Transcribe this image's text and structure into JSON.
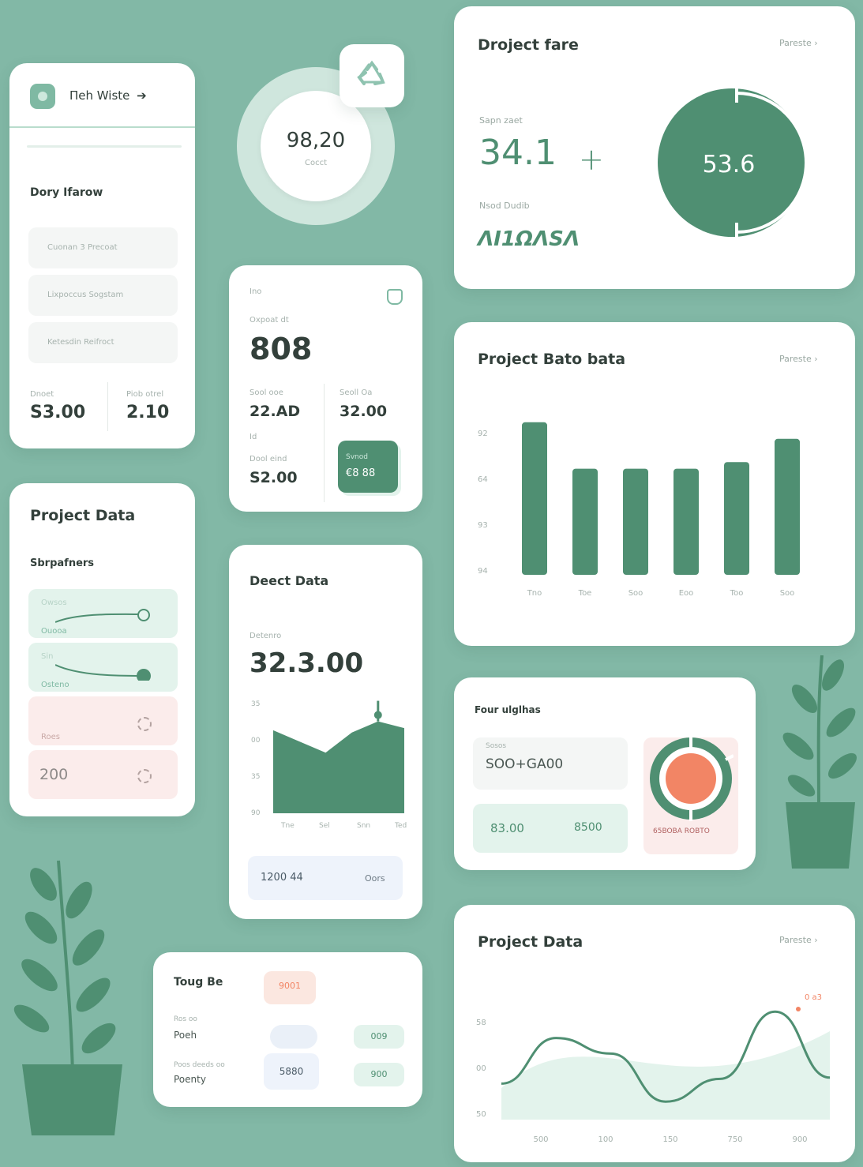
{
  "colors": {
    "background": "#82b8a6",
    "accent": "#4f8f72",
    "accent_light": "#e3f3ec",
    "coral": "#f28565",
    "pink_light": "#fbeceb"
  },
  "user_card": {
    "title": "Пeh Wiste",
    "section_title": "Dory Ifarow",
    "items": [
      "Cuonan 3 Precoat",
      "Lixpoccus Sogstam",
      "Ketesdin Reifroct"
    ],
    "stats": [
      {
        "label": "Dnoet",
        "value": "S3.00"
      },
      {
        "label": "Piob otrel",
        "value": "2.10"
      }
    ]
  },
  "ring_widget": {
    "value": "98,20",
    "label": "Cocct"
  },
  "project_fare": {
    "title": "Droject fare",
    "link": "Pareste",
    "label1": "Sapn zaet",
    "value1": "34.1",
    "plus": "+",
    "label2": "Nsod Dudib",
    "value2": "ΛΙ1ΩΛSΛ",
    "donut_value": "53.6",
    "donut_fraction": 0.5
  },
  "small_card": {
    "tag": "Ino",
    "label": "Oxpoat dt",
    "value": "808",
    "cells": [
      {
        "label": "Sool ooe",
        "value": "22.AD"
      },
      {
        "label": "Seoll Oa",
        "value": "32.00"
      },
      {
        "label": "Dool eind",
        "value": "S2.00"
      }
    ],
    "sub_tag": "Id",
    "badge": {
      "label": "Svnod",
      "value": "€8 88"
    }
  },
  "bar_card": {
    "title": "Project Bato bata",
    "link": "Pareste",
    "chart_data": {
      "type": "bar",
      "categories": [
        "Tno",
        "Toe",
        "Soo",
        "Eoo",
        "Too",
        "Soo"
      ],
      "values": [
        92,
        64,
        64,
        64,
        68,
        82
      ],
      "yticks": [
        "92",
        "64",
        "93",
        "94"
      ],
      "ylim": [
        0,
        100
      ],
      "grid": false
    }
  },
  "project_data": {
    "title": "Project Data",
    "subtitle": "Sbrpafners",
    "rows": [
      {
        "top": "Owsos",
        "bottom": "Ouooa",
        "slider": 0.9,
        "fill": "empty"
      },
      {
        "top": "Sin",
        "bottom": "Osteno",
        "slider": 0.9,
        "fill": "solid"
      },
      {
        "top": "",
        "bottom": "Roes",
        "slider": null,
        "fill": "none"
      },
      {
        "top": "",
        "bottom": "200",
        "slider": null,
        "fill": "none"
      }
    ]
  },
  "area_card": {
    "title": "Deect Data",
    "label": "Detenro",
    "value": "32.3.00",
    "chart_data": {
      "type": "area",
      "x": [
        "Tne",
        "Sel",
        "Snn",
        "Ted"
      ],
      "values": [
        74,
        64,
        54,
        72,
        82,
        76
      ],
      "yticks": [
        "35",
        "00",
        "35",
        "90"
      ],
      "ylim": [
        0,
        100
      ]
    },
    "footer_left": "1200 44",
    "footer_right": "Oors"
  },
  "four_card": {
    "title": "Four ulglhas",
    "box_label": "Sosos",
    "box_value": "SOO+GA00",
    "values": [
      "83.00",
      "8500"
    ],
    "donut_label": "65BOBA ROBTO"
  },
  "toug_card": {
    "title": "Toug Be",
    "badge_top": "9001",
    "row1_label": "Ros oo",
    "row1_value": "Poeh",
    "row1_badge": "009",
    "row2_label": "Poos deeds oo",
    "row2_value": "Poenty",
    "row2_mid": "5880",
    "row2_badge": "900"
  },
  "wave_card": {
    "title": "Project Data",
    "link": "Pareste",
    "annotation": "0 a3",
    "chart_data": {
      "type": "line",
      "x": [
        "500",
        "100",
        "150",
        "750",
        "900"
      ],
      "yticks": [
        "58",
        "00",
        "50"
      ],
      "series": [
        {
          "values": [
            30,
            68,
            55,
            15,
            34,
            90,
            35
          ]
        }
      ]
    }
  }
}
